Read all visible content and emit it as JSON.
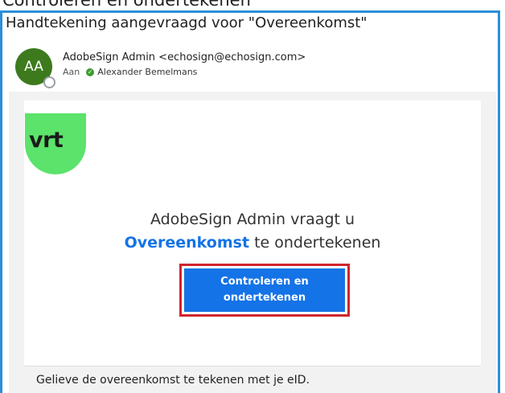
{
  "window": {
    "cut_title": "Controleren en ondertekenen"
  },
  "email": {
    "subject": "Handtekening aangevraagd voor \"Overeenkomst\"",
    "sender": {
      "initials": "AA",
      "display": "AdobeSign Admin <echosign@echosign.com>",
      "avatar_color": "#3d7a1e"
    },
    "recipients": {
      "label": "Aan",
      "names": [
        "Alexander Bemelmans"
      ]
    }
  },
  "message": {
    "logo_text": "vrt",
    "logo_color": "#5be36b",
    "headline_line1": "AdobeSign Admin vraagt u",
    "document_name": "Overeenkomst",
    "headline_suffix": " te ondertekenen",
    "cta_label": "Controleren en\nondertekenen",
    "cta_color": "#1473e6",
    "highlight_color": "#d0242b",
    "body": "Gelieve de overeenkomst te tekenen met je eID."
  }
}
